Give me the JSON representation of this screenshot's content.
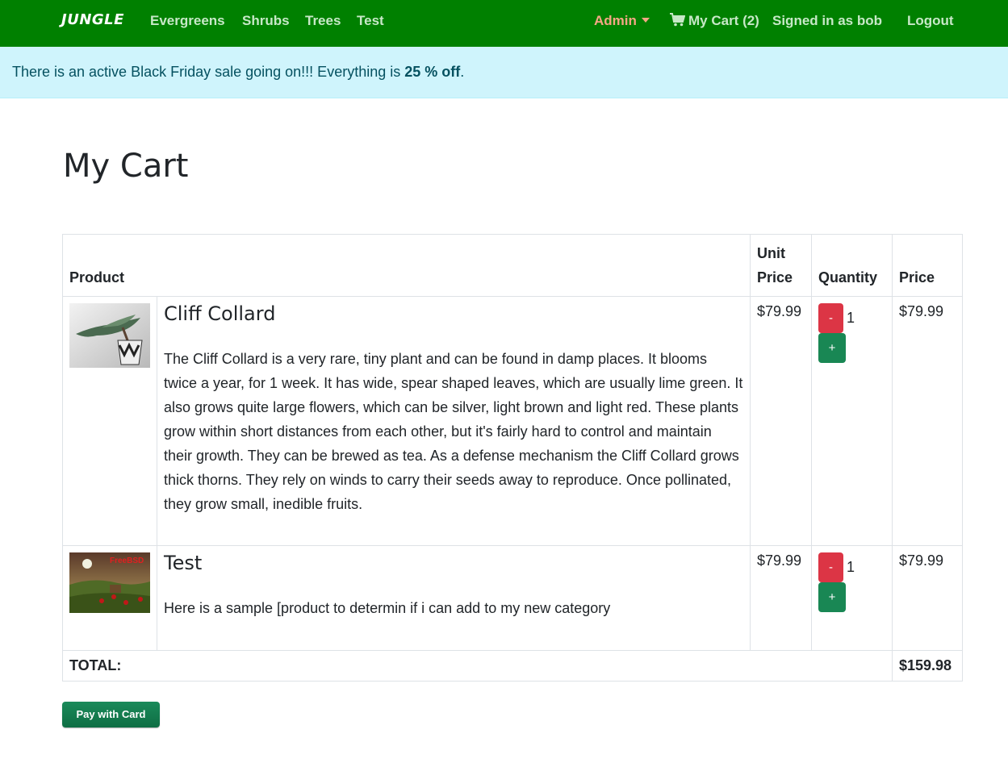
{
  "nav": {
    "brand": "JUNGLE",
    "links": [
      "Evergreens",
      "Shrubs",
      "Trees",
      "Test"
    ],
    "admin": "Admin",
    "cart": "My Cart (2)",
    "signed_in": "Signed in as bob",
    "logout": "Logout"
  },
  "alert": {
    "text_before": "There is an active Black Friday sale going on!!! Everything is ",
    "discount": "25 % off",
    "text_after": "."
  },
  "page_title": "My Cart",
  "table": {
    "headers": {
      "product": "Product",
      "unit_price_1": "Unit",
      "unit_price_2": "Price",
      "quantity": "Quantity",
      "price": "Price"
    },
    "items": [
      {
        "name": "Cliff Collard",
        "description": "The Cliff Collard is a very rare, tiny plant and can be found in damp places. It blooms twice a year, for 1 week. It has wide, spear shaped leaves, which are usually lime green. It also grows quite large flowers, which can be silver, light brown and light red. These plants grow within short distances from each other, but it's fairly hard to control and maintain their growth. They can be brewed as tea. As a defense mechanism the Cliff Collard grows thick thorns. They rely on winds to carry their seeds away to reproduce. Once pollinated, they grow small, inedible fruits.",
        "unit_price": "$79.99",
        "quantity": "1",
        "price": "$79.99"
      },
      {
        "name": "Test",
        "description": "Here is a sample [product to determin if i can add to my new category",
        "unit_price": "$79.99",
        "quantity": "1",
        "price": "$79.99"
      }
    ],
    "minus_label": "-",
    "plus_label": "+",
    "total_label": "TOTAL:",
    "total_value": "$159.98"
  },
  "pay_button": "Pay with Card",
  "image_logo_text": "FreeBSD",
  "colors": {
    "navbar": "#008000",
    "alert_bg": "#cff4fc",
    "minus_btn": "#dc3545",
    "plus_btn": "#198754"
  }
}
